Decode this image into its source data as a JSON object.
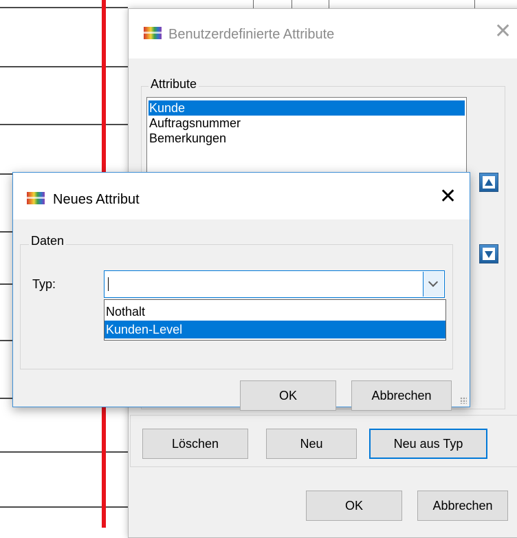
{
  "back_dialog": {
    "title": "Benutzerdefinierte Attribute",
    "close_glyph": "✕",
    "group_label": "Attribute",
    "attributes": [
      {
        "label": "Kunde",
        "selected": true
      },
      {
        "label": "Auftragsnummer",
        "selected": false
      },
      {
        "label": "Bemerkungen",
        "selected": false
      }
    ],
    "buttons": {
      "loeschen": "Löschen",
      "neu": "Neu",
      "neu_aus_typ": "Neu aus Typ",
      "ok": "OK",
      "abbrechen": "Abbrechen"
    }
  },
  "front_dialog": {
    "title": "Neues Attribut",
    "close_glyph": "✕",
    "group_label": "Daten",
    "typ_label": "Typ:",
    "typ_value": "",
    "dropdown_options": [
      {
        "label": "Nothalt",
        "highlighted": false
      },
      {
        "label": "Kunden-Level",
        "highlighted": true
      }
    ],
    "buttons": {
      "ok": "OK",
      "abbrechen": "Abbrechen"
    }
  },
  "colors": {
    "accent": "#0078d7",
    "red_line": "#e8131b",
    "dialog_bg": "#f0f0f0"
  },
  "icons": [
    "app-icon",
    "close-icon",
    "move-up-icon",
    "move-down-icon",
    "chevron-down-icon",
    "resize-grip-icon"
  ]
}
